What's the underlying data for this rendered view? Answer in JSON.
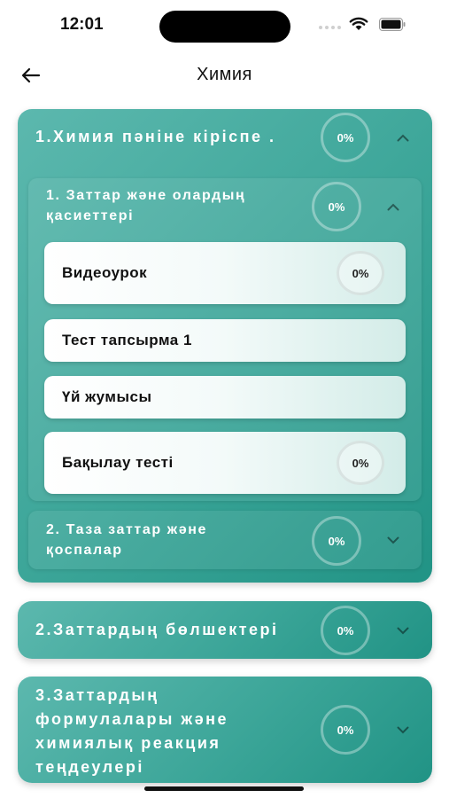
{
  "status": {
    "time": "12:01"
  },
  "header": {
    "title": "Химия"
  },
  "sections": [
    {
      "title": "1.Химия пәніне кіріспе .",
      "progress": "0%",
      "expanded": true,
      "topics": [
        {
          "title_line1": "1. Заттар және олардың",
          "title_line2": "қасиеттері",
          "progress": "0%",
          "expanded": true,
          "lessons": [
            {
              "label": "Видеоурок",
              "progress": "0%"
            },
            {
              "label": "Тест тапсырма 1"
            },
            {
              "label": "Үй жумысы"
            },
            {
              "label": "Бақылау тесті",
              "progress": "0%"
            }
          ]
        },
        {
          "title_line1": "2. Таза заттар және",
          "title_line2": "қоспалар",
          "progress": "0%",
          "expanded": false
        }
      ]
    },
    {
      "title": "2.Заттардың бөлшектері",
      "progress": "0%",
      "expanded": false
    },
    {
      "title_lines": [
        "3.Заттардың",
        "формулалары және",
        "химиялық реакция",
        "теңдеулері"
      ],
      "progress": "0%",
      "expanded": false
    }
  ],
  "icons": {
    "back": "arrow-left-icon",
    "expand": "chevron-down-icon",
    "collapse": "chevron-up-icon"
  },
  "colors": {
    "accent": "#3ba598",
    "accent_dark": "#219385",
    "accent_light": "#5cb8ae"
  }
}
